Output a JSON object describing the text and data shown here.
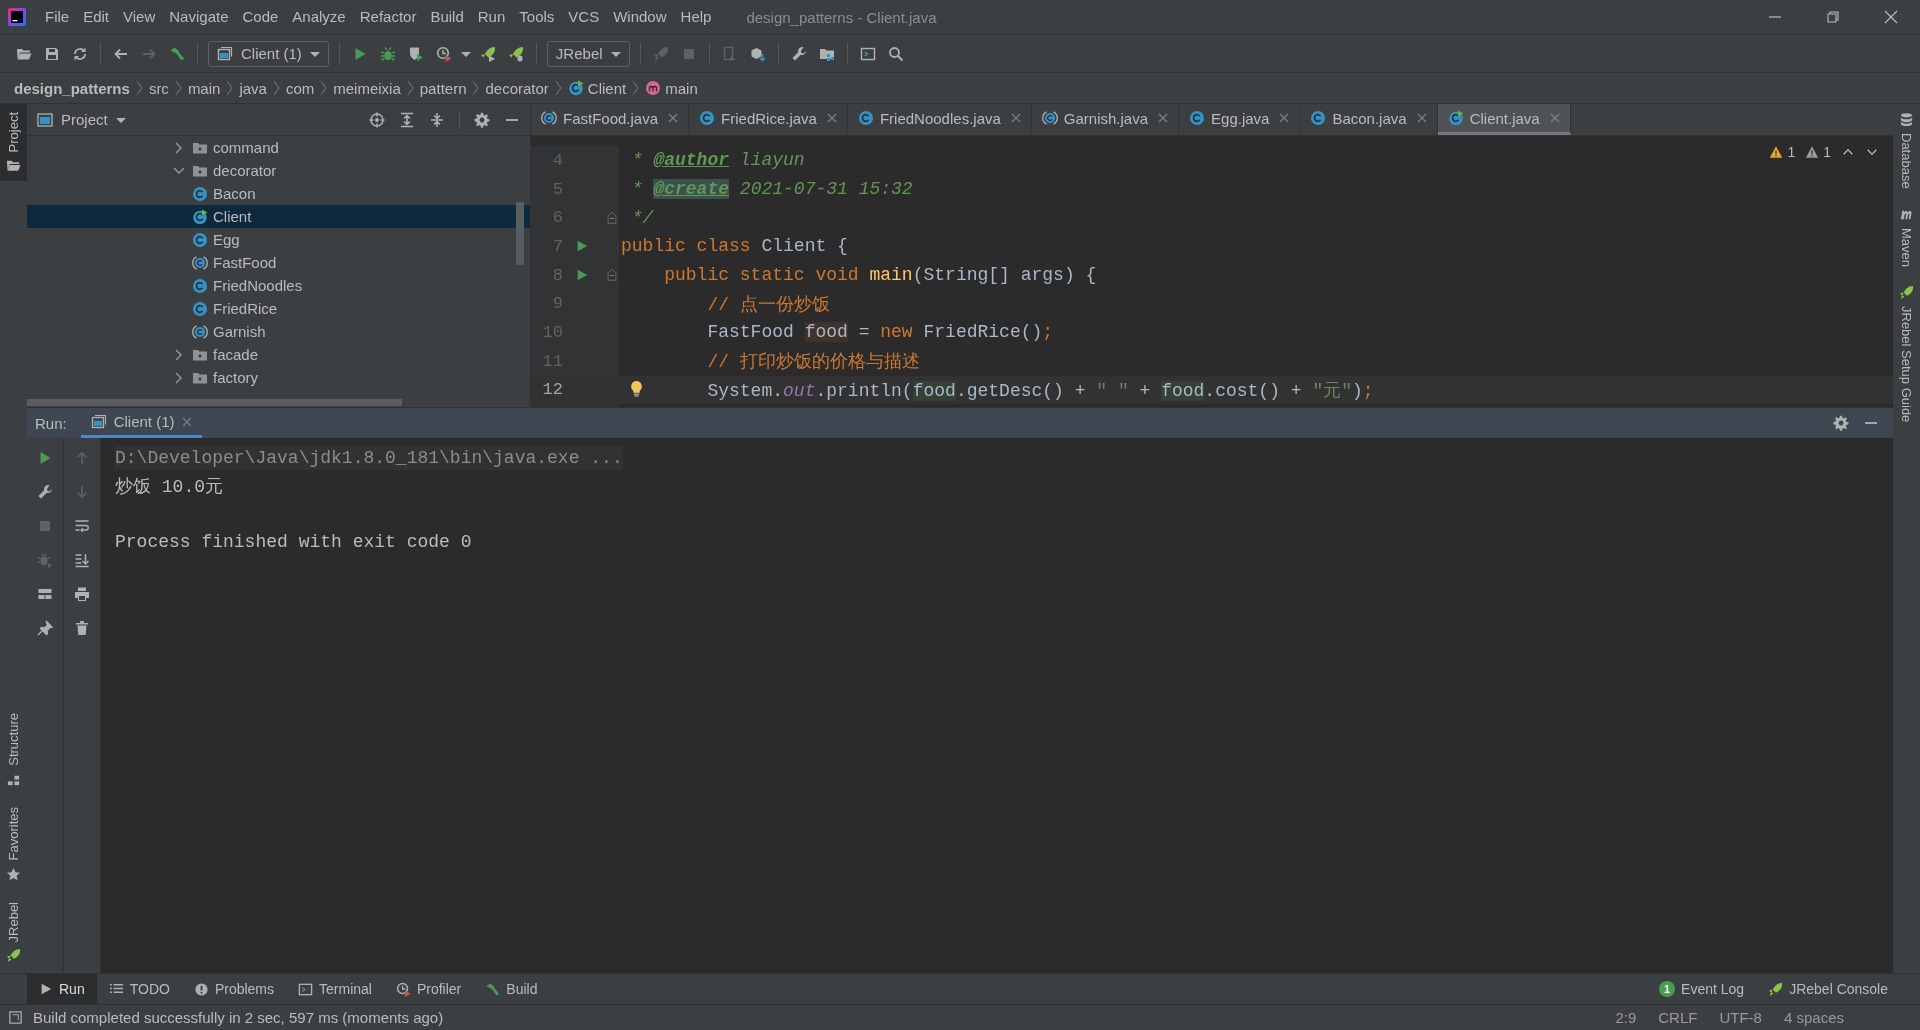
{
  "window": {
    "title": "design_patterns - Client.java"
  },
  "menu": [
    "File",
    "Edit",
    "View",
    "Navigate",
    "Code",
    "Analyze",
    "Refactor",
    "Build",
    "Run",
    "Tools",
    "VCS",
    "Window",
    "Help"
  ],
  "toolbar": {
    "groups": [
      [
        {
          "kind": "open"
        },
        {
          "kind": "save"
        },
        {
          "kind": "sync"
        }
      ],
      [
        {
          "kind": "back",
          "disabled": false
        },
        {
          "kind": "forward",
          "disabled": true
        },
        {
          "kind": "build"
        }
      ],
      [
        {
          "kind": "dropdown",
          "label": "Client (1)"
        }
      ],
      [
        {
          "kind": "run"
        },
        {
          "kind": "debug"
        },
        {
          "kind": "coverage"
        },
        {
          "kind": "profile"
        },
        {
          "kind": "caret"
        },
        {
          "kind": "jrebel-run"
        },
        {
          "kind": "jrebel-debug"
        }
      ],
      [
        {
          "kind": "dropdown",
          "label": "JRebel"
        }
      ],
      [
        {
          "kind": "attach",
          "disabled": true
        },
        {
          "kind": "stop",
          "disabled": true
        }
      ],
      [
        {
          "kind": "device",
          "disabled": true
        },
        {
          "kind": "deploy"
        }
      ],
      [
        {
          "kind": "wrench"
        },
        {
          "kind": "structure"
        }
      ],
      [
        {
          "kind": "terminal"
        },
        {
          "kind": "search"
        }
      ]
    ]
  },
  "breadcrumb": [
    {
      "label": "design_patterns",
      "kind": "project"
    },
    {
      "label": "src",
      "kind": "folder"
    },
    {
      "label": "main",
      "kind": "folder"
    },
    {
      "label": "java",
      "kind": "folder"
    },
    {
      "label": "com",
      "kind": "folder"
    },
    {
      "label": "meimeixia",
      "kind": "folder"
    },
    {
      "label": "pattern",
      "kind": "folder"
    },
    {
      "label": "decorator",
      "kind": "folder"
    },
    {
      "label": "Client",
      "kind": "main-class"
    },
    {
      "label": "main",
      "kind": "method"
    }
  ],
  "left_stripe": {
    "top": [
      {
        "label": "Project",
        "selected": true
      }
    ],
    "bottom": [
      {
        "label": "Structure",
        "selected": false
      },
      {
        "label": "Favorites",
        "selected": false
      },
      {
        "label": "JRebel",
        "selected": false
      }
    ]
  },
  "right_stripe": [
    {
      "label": "Database",
      "kind": "database"
    },
    {
      "label": "Maven",
      "kind": "maven"
    },
    {
      "label": "JRebel Setup Guide",
      "kind": "jrebel"
    }
  ],
  "project_panel": {
    "title": "Project",
    "tree": [
      {
        "label": "command",
        "kind": "package",
        "expanded": false,
        "selected": false
      },
      {
        "label": "decorator",
        "kind": "package",
        "expanded": true,
        "selected": false,
        "children": [
          {
            "label": "Bacon",
            "kind": "class",
            "selected": false
          },
          {
            "label": "Client",
            "kind": "main-class",
            "selected": true
          },
          {
            "label": "Egg",
            "kind": "class",
            "selected": false
          },
          {
            "label": "FastFood",
            "kind": "abstract-class",
            "selected": false
          },
          {
            "label": "FriedNoodles",
            "kind": "class",
            "selected": false
          },
          {
            "label": "FriedRice",
            "kind": "class",
            "selected": false
          },
          {
            "label": "Garnish",
            "kind": "abstract-class",
            "selected": false
          }
        ]
      },
      {
        "label": "facade",
        "kind": "package",
        "expanded": false,
        "selected": false
      },
      {
        "label": "factory",
        "kind": "package",
        "expanded": false,
        "selected": false
      }
    ]
  },
  "editor_tabs": [
    {
      "label": "FastFood.java",
      "kind": "abstract-class",
      "selected": false
    },
    {
      "label": "FriedRice.java",
      "kind": "class",
      "selected": false
    },
    {
      "label": "FriedNoodles.java",
      "kind": "class",
      "selected": false
    },
    {
      "label": "Garnish.java",
      "kind": "abstract-class",
      "selected": false
    },
    {
      "label": "Egg.java",
      "kind": "class",
      "selected": false
    },
    {
      "label": "Bacon.java",
      "kind": "class",
      "selected": false
    },
    {
      "label": "Client.java",
      "kind": "main-class",
      "selected": true
    }
  ],
  "editor": {
    "inspections": [
      {
        "kind": "warning",
        "count": "1"
      },
      {
        "kind": "weak-warning",
        "count": "1"
      }
    ],
    "lines": [
      {
        "number": "4",
        "tokens": [
          {
            "text": " * ",
            "kind": "doc"
          },
          {
            "text": "@author",
            "kind": "doc-tag"
          },
          {
            "text": " liayun",
            "kind": "doc"
          }
        ]
      },
      {
        "number": "5",
        "tokens": [
          {
            "text": " * ",
            "kind": "doc"
          },
          {
            "text": "@create",
            "kind": "doc-tag-match"
          },
          {
            "text": " 2021-07-31 15:32",
            "kind": "doc"
          }
        ]
      },
      {
        "number": "6",
        "fold": true,
        "tokens": [
          {
            "text": " */",
            "kind": "doc"
          }
        ]
      },
      {
        "number": "7",
        "run": true,
        "tokens": [
          {
            "text": "public class ",
            "kind": "keyword"
          },
          {
            "text": "Client {",
            "kind": "plain"
          }
        ]
      },
      {
        "number": "8",
        "run": true,
        "fold": true,
        "tokens": [
          {
            "text": "    public static void ",
            "kind": "keyword"
          },
          {
            "text": "main",
            "kind": "method"
          },
          {
            "text": "(String[] args) {",
            "kind": "plain"
          }
        ]
      },
      {
        "number": "9",
        "tokens": [
          {
            "text": "        // 点一份炒饭",
            "kind": "comment"
          }
        ]
      },
      {
        "number": "10",
        "tokens": [
          {
            "text": "        FastFood ",
            "kind": "plain"
          },
          {
            "text": "food",
            "kind": "usage-write"
          },
          {
            "text": " = ",
            "kind": "plain"
          },
          {
            "text": "new ",
            "kind": "keyword"
          },
          {
            "text": "FriedRice()",
            "kind": "plain"
          },
          {
            "text": ";",
            "kind": "keyword"
          }
        ]
      },
      {
        "number": "11",
        "tokens": [
          {
            "text": "        // 打印炒饭的价格与描述",
            "kind": "comment"
          }
        ]
      },
      {
        "number": "12",
        "current": true,
        "bulb": true,
        "tokens": [
          {
            "text": "        System.",
            "kind": "plain"
          },
          {
            "text": "out",
            "kind": "static"
          },
          {
            "text": ".println(",
            "kind": "plain"
          },
          {
            "text": "food",
            "kind": "usage"
          },
          {
            "text": ".getDesc() + ",
            "kind": "plain"
          },
          {
            "text": "\" \"",
            "kind": "string"
          },
          {
            "text": " + ",
            "kind": "plain"
          },
          {
            "text": "food",
            "kind": "usage"
          },
          {
            "text": ".cost() + ",
            "kind": "plain"
          },
          {
            "text": "\"元\"",
            "kind": "string"
          },
          {
            "text": ")",
            "kind": "plain"
          },
          {
            "text": ";",
            "kind": "keyword"
          }
        ]
      }
    ]
  },
  "run_panel": {
    "label": "Run:",
    "tabs": [
      {
        "label": "Client (1)",
        "selected": true
      }
    ],
    "tools": [
      [
        {
          "kind": "run"
        },
        {
          "kind": "wrench"
        },
        {
          "kind": "stop",
          "disabled": true
        },
        {
          "kind": "bug-attach",
          "disabled": true
        },
        {
          "kind": "layout"
        },
        {
          "kind": "pin"
        }
      ],
      [
        {
          "kind": "up",
          "disabled": true
        },
        {
          "kind": "down",
          "disabled": true
        },
        {
          "kind": "wrap"
        },
        {
          "kind": "scroll-end"
        },
        {
          "kind": "print"
        },
        {
          "kind": "trash"
        }
      ]
    ],
    "output": [
      {
        "text": "D:\\Developer\\Java\\jdk1.8.0_181\\bin\\java.exe ...",
        "kind": "command"
      },
      {
        "text": "炒饭 10.0元",
        "kind": "stdout"
      },
      {
        "text": "Process finished with exit code 0",
        "kind": "exit"
      }
    ]
  },
  "tool_tabs": [
    {
      "label": "Run",
      "kind": "run",
      "selected": true
    },
    {
      "label": "TODO",
      "kind": "todo",
      "selected": false
    },
    {
      "label": "Problems",
      "kind": "problems",
      "selected": false
    },
    {
      "label": "Terminal",
      "kind": "terminal",
      "selected": false
    },
    {
      "label": "Profiler",
      "kind": "profile",
      "selected": false
    },
    {
      "label": "Build",
      "kind": "build",
      "selected": false
    }
  ],
  "right_tools": [
    {
      "label": "Event Log",
      "badge": "1",
      "kind": "event-log"
    },
    {
      "label": "JRebel Console",
      "kind": "jrebel"
    }
  ],
  "status_bar": {
    "message": "Build completed successfully in 2 sec, 597 ms (moments ago)",
    "indicators": [
      "2:9",
      "CRLF",
      "UTF-8",
      "4 spaces"
    ]
  }
}
